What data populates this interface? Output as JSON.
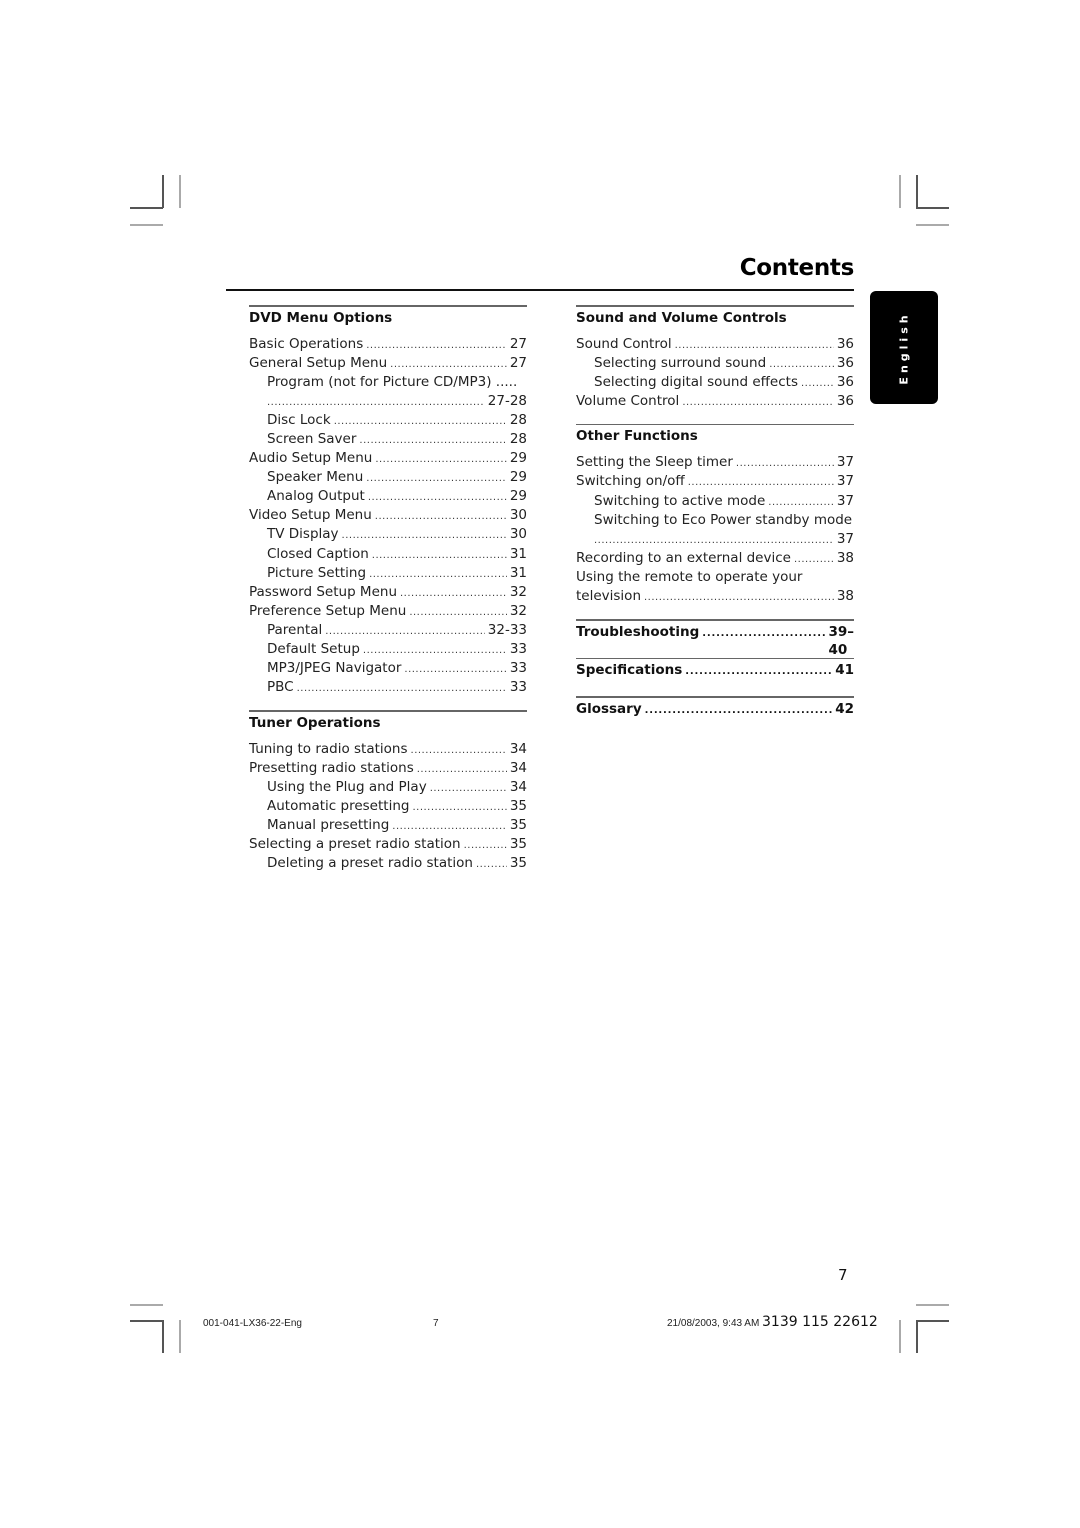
{
  "page": {
    "title": "Contents",
    "language_tab": "English",
    "page_number": "7"
  },
  "left_column": {
    "sections": [
      {
        "heading": "DVD Menu Options",
        "entries": [
          {
            "label": "Basic Operations",
            "page": "27",
            "level": 0
          },
          {
            "label": "General Setup Menu",
            "page": "27",
            "level": 0
          },
          {
            "label": "Program (not for Picture CD/MP3) .....",
            "page": "",
            "level": 1,
            "wrap": true
          },
          {
            "label": "",
            "page": "27-28",
            "level": 1,
            "cont": true
          },
          {
            "label": "Disc Lock",
            "page": "28",
            "level": 1
          },
          {
            "label": "Screen Saver",
            "page": "28",
            "level": 1
          },
          {
            "label": "Audio Setup Menu",
            "page": "29",
            "level": 0
          },
          {
            "label": "Speaker Menu",
            "page": "29",
            "level": 1
          },
          {
            "label": "Analog Output",
            "page": "29",
            "level": 1
          },
          {
            "label": "Video Setup Menu",
            "page": "30",
            "level": 0
          },
          {
            "label": "TV Display",
            "page": "30",
            "level": 1
          },
          {
            "label": "Closed Caption",
            "page": "31",
            "level": 1
          },
          {
            "label": "Picture Setting",
            "page": "31",
            "level": 1
          },
          {
            "label": "Password Setup Menu",
            "page": "32",
            "level": 0
          },
          {
            "label": "Preference Setup Menu",
            "page": "32",
            "level": 0
          },
          {
            "label": "Parental",
            "page": "32-33",
            "level": 1
          },
          {
            "label": "Default Setup",
            "page": "33",
            "level": 1
          },
          {
            "label": "MP3/JPEG Navigator",
            "page": "33",
            "level": 1
          },
          {
            "label": "PBC",
            "page": "33",
            "level": 1
          }
        ]
      },
      {
        "heading": "Tuner Operations",
        "entries": [
          {
            "label": "Tuning to radio stations",
            "page": "34",
            "level": 0
          },
          {
            "label": "Presetting radio stations",
            "page": "34",
            "level": 0
          },
          {
            "label": "Using the Plug and Play",
            "page": "34",
            "level": 1
          },
          {
            "label": "Automatic presetting",
            "page": "35",
            "level": 1
          },
          {
            "label": "Manual presetting",
            "page": "35",
            "level": 1
          },
          {
            "label": "Selecting a preset radio station",
            "page": "35",
            "level": 0
          },
          {
            "label": "Deleting a preset radio station",
            "page": "35",
            "level": 1
          }
        ]
      }
    ]
  },
  "right_column": {
    "sections": [
      {
        "heading": "Sound and Volume Controls",
        "entries": [
          {
            "label": "Sound Control",
            "page": "36",
            "level": 0
          },
          {
            "label": "Selecting surround sound",
            "page": "36",
            "level": 1
          },
          {
            "label": "Selecting digital sound effects",
            "page": "36",
            "level": 1
          },
          {
            "label": "Volume Control",
            "page": "36",
            "level": 0
          }
        ]
      },
      {
        "heading": "Other Functions",
        "entries": [
          {
            "label": "Setting the Sleep timer",
            "page": "37",
            "level": 0
          },
          {
            "label": "Switching on/off",
            "page": "37",
            "level": 0
          },
          {
            "label": "Switching to active mode",
            "page": "37",
            "level": 1
          },
          {
            "label": "Switching to Eco Power standby mode",
            "page": "",
            "level": 1,
            "wrap": true
          },
          {
            "label": "",
            "page": "37",
            "level": 1,
            "cont": true
          },
          {
            "label": "Recording to an external device",
            "page": "38",
            "level": 0
          },
          {
            "label": "Using the remote to operate your",
            "page": "",
            "level": 0,
            "wrap": true
          },
          {
            "label": "television",
            "page": "38",
            "level": 0
          }
        ]
      }
    ],
    "bold_entries": [
      {
        "label": "Troubleshooting",
        "page": "39–40"
      },
      {
        "label": "Specifications",
        "page": "41"
      },
      {
        "label": "Glossary",
        "page": "42"
      }
    ]
  },
  "footer": {
    "file_code": "001-041-LX36-22-Eng",
    "print_page": "7",
    "timestamp": "21/08/2003, 9:43 AM",
    "part_number": "3139 115 22612"
  }
}
